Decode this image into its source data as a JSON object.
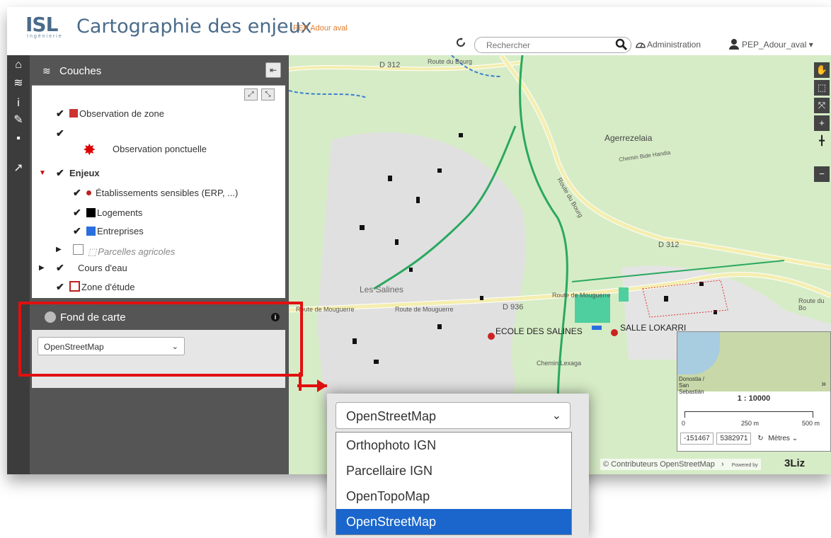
{
  "header": {
    "logo": "ISL",
    "logo_sub": "Ingénierie",
    "title": "Cartographie des enjeux",
    "subtitle": "PEP Adour aval",
    "search_placeholder": "Rechercher",
    "admin_label": "Administration",
    "user_label": "PEP_Adour_aval ▾"
  },
  "panel": {
    "couches_title": "Couches",
    "layers": [
      {
        "label": "Observation de zone",
        "checked": true
      },
      {
        "label": "Observation ponctuelle",
        "checked": true
      },
      {
        "label": "Enjeux",
        "checked": true
      },
      {
        "label": "Établissements sensibles (ERP, ...)",
        "checked": true
      },
      {
        "label": "Logements",
        "checked": true
      },
      {
        "label": "Entreprises",
        "checked": true
      },
      {
        "label": "Parcelles agricoles",
        "checked": false
      },
      {
        "label": "Cours d'eau",
        "checked": true
      },
      {
        "label": "Zone d'étude",
        "checked": true
      }
    ],
    "fond_title": "Fond de carte",
    "fond_value": "OpenStreetMap"
  },
  "map": {
    "labels": {
      "d312_a": "D 312",
      "route_bourg_a": "Route du Bourg",
      "agerrezelaia": "Agerrezelaia",
      "chemin_bide": "Chemin Bide Handia",
      "route_bourg_b": "Route du Bourg",
      "d312_b": "D 312",
      "les_salines": "Les Salines",
      "route_mouguerre_a": "Route de Mouguerre",
      "route_mouguerre_b": "Route de Mouguerre",
      "route_mouguerre_c": "Route de Mouguerre",
      "d936": "D 936",
      "ecole": "ECOLE DES SALINES",
      "salle": "SALLE LOKARRI",
      "chemin_lexaga": "Chemin Lexaga",
      "route_du_bo": "Route du Bo"
    },
    "scale": "1 : 10000",
    "scale_250": "250 m",
    "scale_500": "500 m",
    "scale_0": "0",
    "coord_x": "-151467",
    "coord_y": "5382971",
    "units": "Mètres",
    "overview_city": "Donostia / San Sebastián",
    "overview_expand": "»",
    "attribution": "© Contributeurs OpenStreetMap",
    "attribution_arrow": "›",
    "powered_by": "Powered by",
    "brand": "3Liz"
  },
  "dropdown": {
    "selected": "OpenStreetMap",
    "options": [
      {
        "label": "Orthophoto IGN"
      },
      {
        "label": "Parcellaire IGN"
      },
      {
        "label": "OpenTopoMap"
      },
      {
        "label": "OpenStreetMap"
      }
    ]
  },
  "colors": {
    "accent": "#4a6b8a",
    "highlight": "#e01010",
    "selected": "#1a66cc"
  }
}
